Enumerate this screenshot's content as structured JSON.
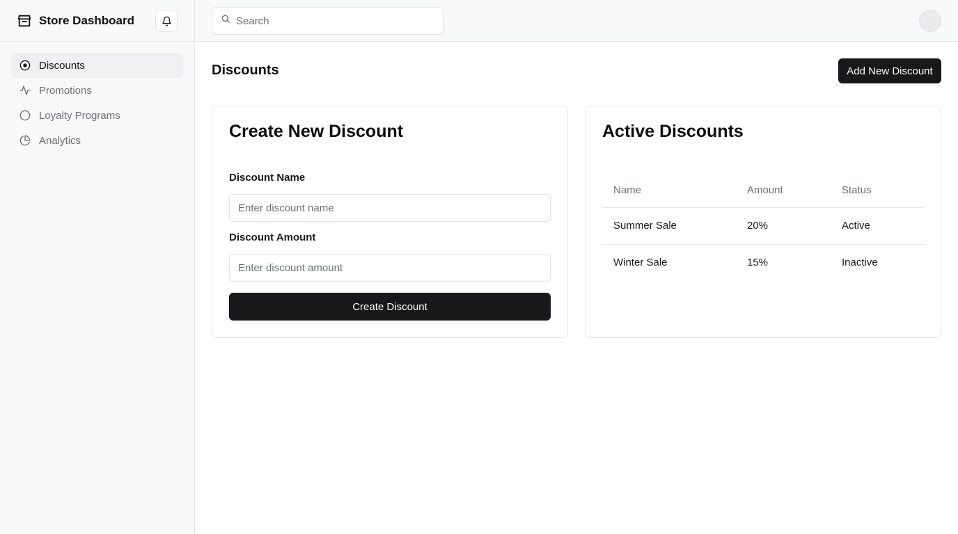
{
  "sidebar": {
    "brand": "Store Dashboard",
    "items": [
      {
        "label": "Discounts",
        "icon": "target-icon",
        "active": true
      },
      {
        "label": "Promotions",
        "icon": "activity-icon",
        "active": false
      },
      {
        "label": "Loyalty Programs",
        "icon": "circle-icon",
        "active": false
      },
      {
        "label": "Analytics",
        "icon": "pie-chart-icon",
        "active": false
      }
    ]
  },
  "header": {
    "search_placeholder": "Search"
  },
  "main": {
    "title": "Discounts",
    "add_button": "Add New Discount",
    "create_card": {
      "title": "Create New Discount",
      "name_label": "Discount Name",
      "name_placeholder": "Enter discount name",
      "amount_label": "Discount Amount",
      "amount_placeholder": "Enter discount amount",
      "submit": "Create Discount"
    },
    "active_card": {
      "title": "Active Discounts",
      "columns": [
        "Name",
        "Amount",
        "Status"
      ],
      "rows": [
        {
          "name": "Summer Sale",
          "amount": "20%",
          "status": "Active"
        },
        {
          "name": "Winter Sale",
          "amount": "15%",
          "status": "Inactive"
        }
      ]
    }
  },
  "colors": {
    "primary_button": "#18181b",
    "sidebar_bg": "#f8f9f9",
    "muted_text": "#6b7076",
    "border": "#e5e7e8"
  }
}
